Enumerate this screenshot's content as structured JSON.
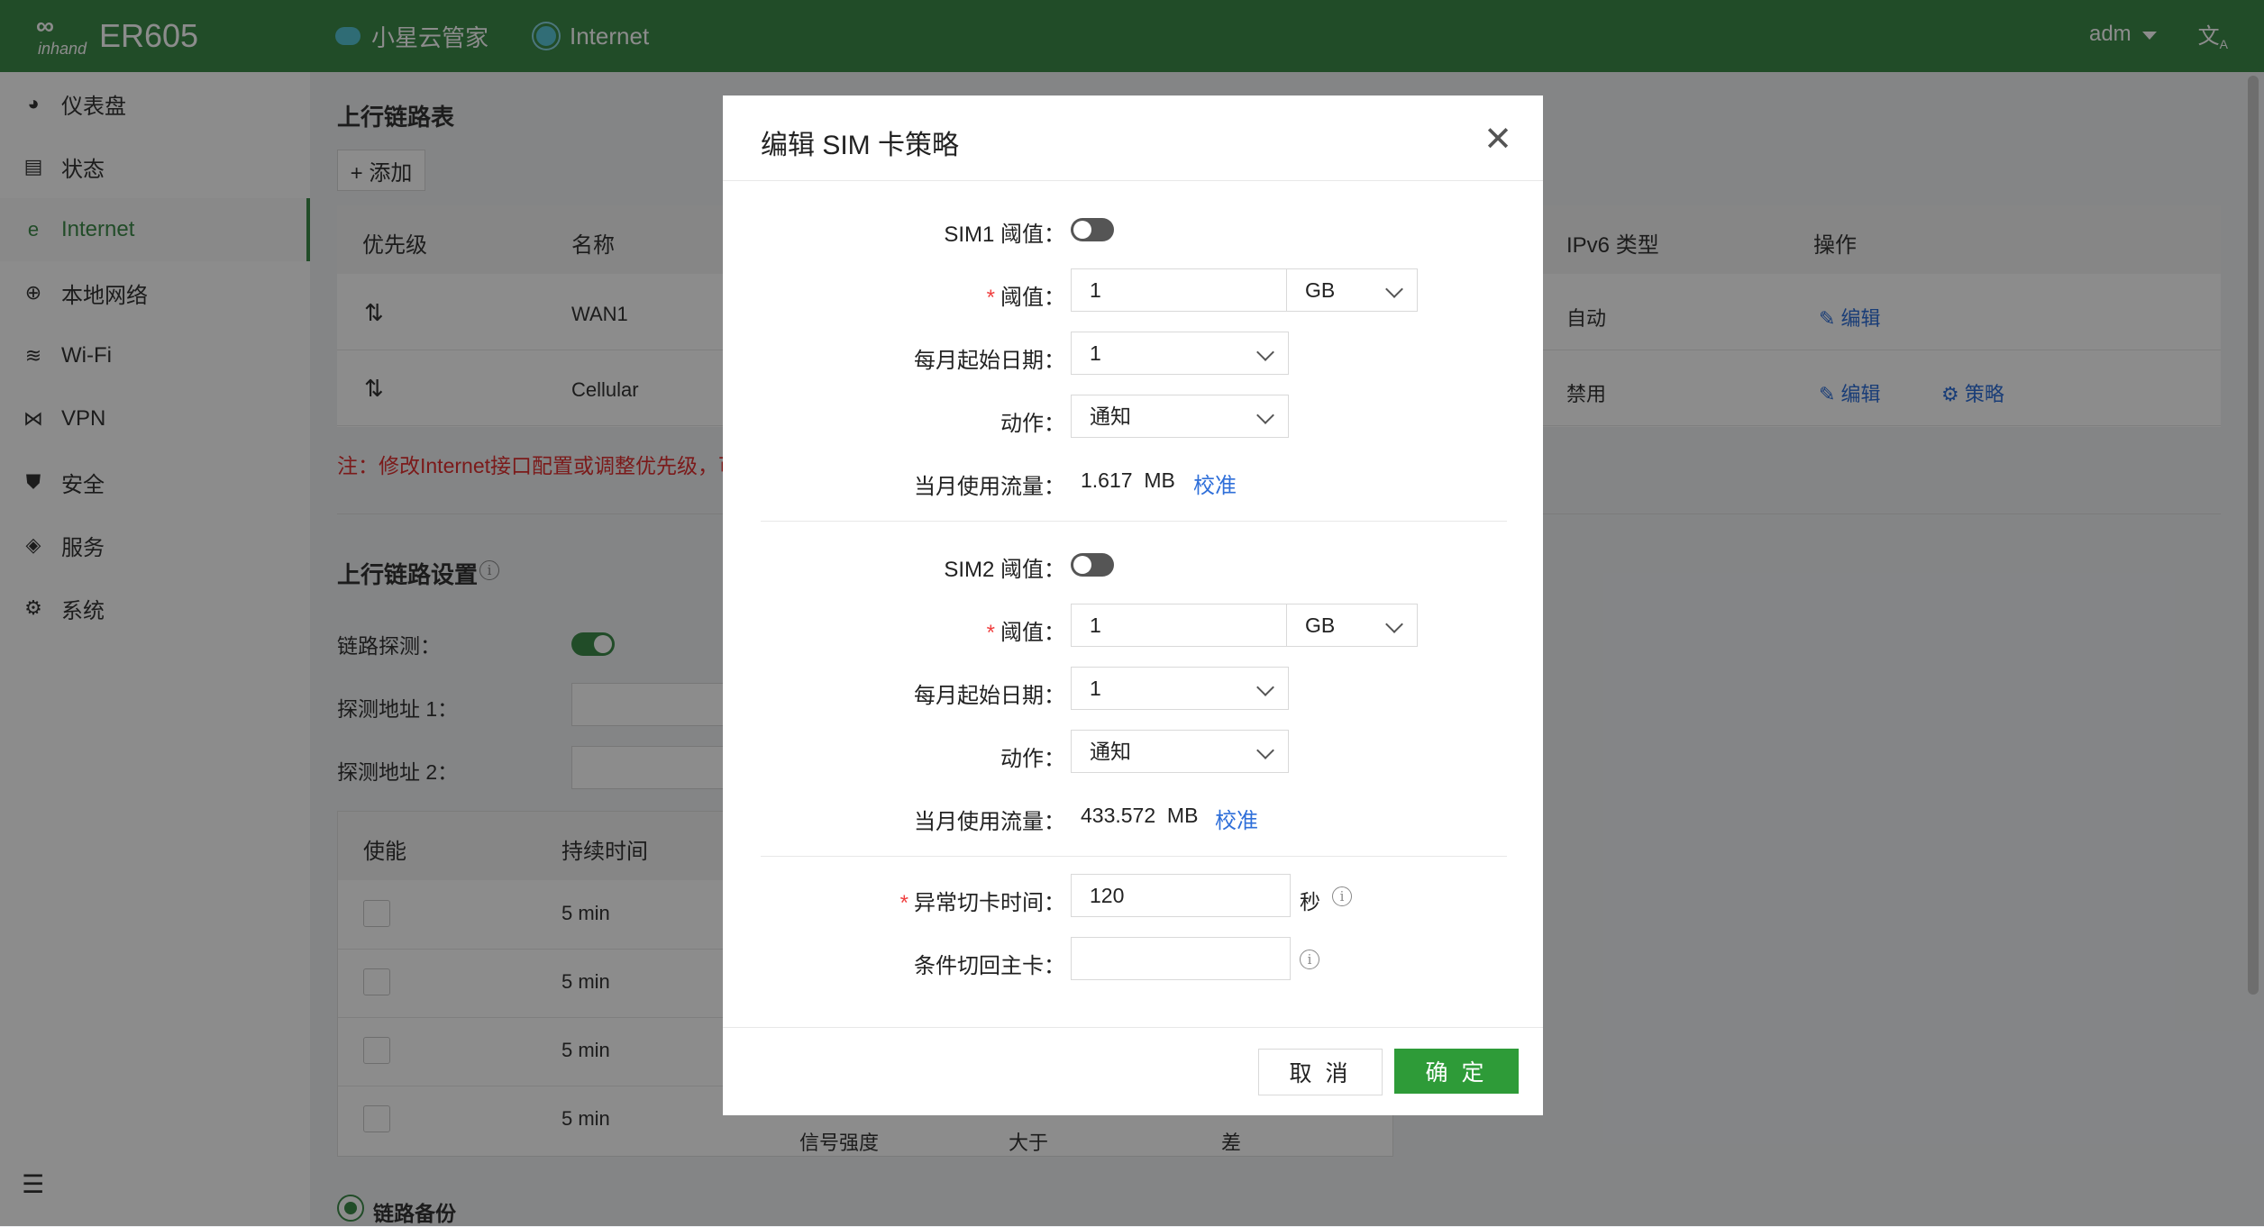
{
  "header": {
    "brand_top": "∞",
    "brand_name": "inhand",
    "model": "ER605",
    "nav": [
      {
        "label": "小星云管家",
        "icon": "cloud-icon"
      },
      {
        "label": "Internet",
        "icon": "status-dot-icon"
      }
    ],
    "user": "adm",
    "lang_icon": "translate-icon"
  },
  "sidebar": {
    "items": [
      {
        "label": "仪表盘",
        "icon": "dashboard-icon"
      },
      {
        "label": "状态",
        "icon": "status-icon"
      },
      {
        "label": "Internet",
        "icon": "internet-icon",
        "active": true
      },
      {
        "label": "本地网络",
        "icon": "globe-icon"
      },
      {
        "label": "Wi-Fi",
        "icon": "wifi-icon"
      },
      {
        "label": "VPN",
        "icon": "vpn-icon"
      },
      {
        "label": "安全",
        "icon": "shield-icon"
      },
      {
        "label": "服务",
        "icon": "cube-icon"
      },
      {
        "label": "系统",
        "icon": "gear-icon"
      }
    ]
  },
  "background": {
    "uplink_table_title": "上行链路表",
    "add_label": "+ 添加",
    "columns": [
      "优先级",
      "名称",
      "IPv6 类型",
      "操作"
    ],
    "rows": [
      {
        "name": "WAN1",
        "ipv6": "自动",
        "edit": "编辑"
      },
      {
        "name": "Cellular",
        "ipv6": "禁用",
        "edit": "编辑",
        "policy": "策略"
      }
    ],
    "note": "注：修改Internet接口配置或调整优先级，可",
    "settings_title": "上行链路设置",
    "link_detect_label": "链路探测：",
    "probe1_label": "探测地址 1：",
    "probe2_label": "探测地址 2：",
    "sub_columns": [
      "使能",
      "持续时间"
    ],
    "sub_rows": [
      "5 min",
      "5 min",
      "5 min",
      "5 min"
    ],
    "last_row_extra": [
      "信号强度",
      "大于",
      "差"
    ],
    "backup_label": "链路备份"
  },
  "modal": {
    "title": "编辑 SIM 卡策略",
    "sim1": {
      "threshold_toggle_label": "SIM1 阈值：",
      "threshold_label": "阈值：",
      "threshold_value": "1",
      "unit": "GB",
      "start_date_label": "每月起始日期：",
      "start_date": "1",
      "action_label": "动作：",
      "action": "通知",
      "usage_label": "当月使用流量：",
      "usage_value": "1.617",
      "usage_unit": "MB",
      "calibrate": "校准"
    },
    "sim2": {
      "threshold_toggle_label": "SIM2 阈值：",
      "threshold_label": "阈值：",
      "threshold_value": "1",
      "unit": "GB",
      "start_date_label": "每月起始日期：",
      "start_date": "1",
      "action_label": "动作：",
      "action": "通知",
      "usage_label": "当月使用流量：",
      "usage_value": "433.572",
      "usage_unit": "MB",
      "calibrate": "校准"
    },
    "switch_time_label": "异常切卡时间：",
    "switch_time_value": "120",
    "switch_time_unit": "秒",
    "fallback_label": "条件切回主卡：",
    "fallback_value": "",
    "cancel": "取 消",
    "ok": "确 定",
    "required_mark": "*"
  }
}
